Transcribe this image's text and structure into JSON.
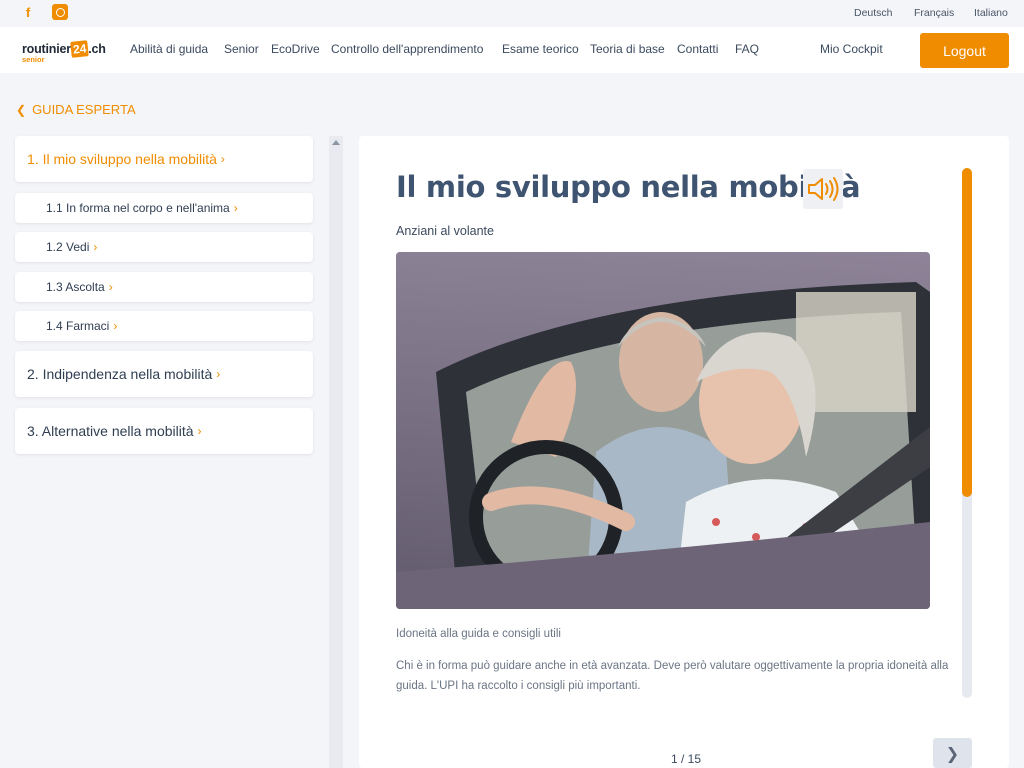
{
  "topbar": {
    "social": [
      {
        "icon": "facebook-icon"
      },
      {
        "icon": "instagram-icon"
      }
    ],
    "languages": [
      "Deutsch",
      "Français",
      "Italiano"
    ]
  },
  "logo": {
    "text": "routinier",
    "badge": "24",
    "domain": ".ch",
    "sub": "senior"
  },
  "nav": {
    "items": [
      "Abilità di guida",
      "Senior",
      "EcoDrive",
      "Controllo dell'apprendimento",
      "Esame teorico",
      "Teoria di base",
      "Contatti",
      "FAQ"
    ],
    "cockpit": "Mio Cockpit",
    "logout": "Logout"
  },
  "back": {
    "label": "GUIDA ESPERTA",
    "icon": "chevron-left-icon"
  },
  "sidebar": {
    "items": [
      {
        "label": "1. Il mio sviluppo nella mobilità",
        "level": "main",
        "active": true
      },
      {
        "label": "1.1 In forma nel corpo e nell'anima",
        "level": "sub"
      },
      {
        "label": "1.2 Vedi",
        "level": "sub"
      },
      {
        "label": "1.3 Ascolta",
        "level": "sub"
      },
      {
        "label": "1.4 Farmaci",
        "level": "sub"
      },
      {
        "label": "2. Indipendenza nella mobilità",
        "level": "main"
      },
      {
        "label": "3. Alternative nella mobilità",
        "level": "main"
      }
    ]
  },
  "content": {
    "title": "Il mio sviluppo nella mobilità",
    "speaker_icon": "speaker-icon",
    "subtitle": "Anziani al volante",
    "caption": "Idoneità alla guida e consigli utili",
    "paragraph": "Chi è in forma può guidare anche in età avanzata. Deve però valutare oggettivamente la propria idoneità alla guida. L'UPI ha raccolto i consigli più importanti.",
    "scroll_fraction": 0.62
  },
  "pager": {
    "text": "1 / 15",
    "next_icon": "chevron-right-icon"
  },
  "colors": {
    "accent": "#f08c00",
    "title": "#3e5470",
    "bg": "#f4f5f8"
  }
}
